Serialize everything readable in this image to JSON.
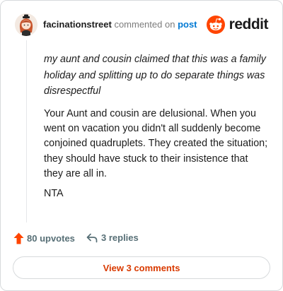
{
  "header": {
    "username": "facinationstreet",
    "action_text": "commented on",
    "link_text": "post",
    "brand": "reddit"
  },
  "comment": {
    "quote": "my aunt and cousin claimed that this was a family holiday and splitting up to do separate things was disrespectful",
    "body": "Your Aunt and cousin are delusional. When you went on vacation you didn't all suddenly become conjoined quadruplets. They created the situation; they should have stuck to their insistence that they are all in.",
    "verdict": "NTA"
  },
  "actions": {
    "upvotes": "80 upvotes",
    "replies": "3 replies"
  },
  "footer": {
    "view_comments": "View 3 comments"
  },
  "colors": {
    "brand_orange": "#ff4500",
    "link_blue": "#0079d3",
    "button_text": "#d93a00",
    "muted": "#576f76"
  }
}
